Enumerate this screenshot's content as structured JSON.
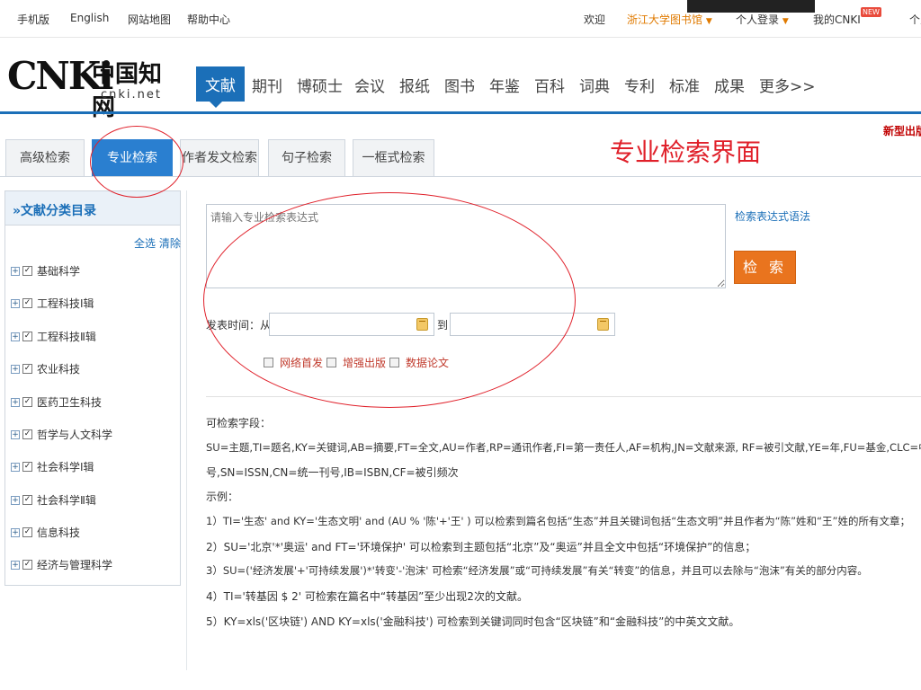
{
  "topbar": {
    "mobile": "手机版",
    "english": "English",
    "sitemap": "网站地图",
    "help": "帮助中心",
    "welcome": "欢迎",
    "library": "浙江大学图书馆",
    "login": "个人登录",
    "my_cnki": "我的CNKI",
    "new_badge": "NEW",
    "personal": "个人"
  },
  "logo": {
    "brand": "CNKi",
    "cn": "中国知网",
    "domain": "cnki.net"
  },
  "nav": {
    "items": [
      "文献",
      "期刊",
      "博硕士",
      "会议",
      "报纸",
      "图书",
      "年鉴",
      "百科",
      "词典",
      "专利",
      "标准",
      "成果",
      "更多>>"
    ],
    "active": "文献"
  },
  "new_edition": "新型出版",
  "tabs": {
    "items": [
      "高级检索",
      "专业检索",
      "作者发文检索",
      "句子检索",
      "一框式检索"
    ],
    "active": "专业检索"
  },
  "annotation": "专业检索界面",
  "sidebar": {
    "title": "»文献分类目录",
    "select_all": "全选",
    "clear": "清除",
    "categories": [
      "基础科学",
      "工程科技Ⅰ辑",
      "工程科技Ⅱ辑",
      "农业科技",
      "医药卫生科技",
      "哲学与人文科学",
      "社会科学Ⅰ辑",
      "社会科学Ⅱ辑",
      "信息科技",
      "经济与管理科学"
    ]
  },
  "form": {
    "expr_placeholder": "请输入专业检索表达式",
    "syntax_link": "检索表达式语法",
    "search_button": "检 索",
    "time_label": "发表时间：从",
    "to_label": "到",
    "options": [
      "网络首发",
      "增强出版",
      "数据论文"
    ]
  },
  "help": {
    "fields_title": "可检索字段：",
    "fields_line1": "SU=主题,TI=题名,KY=关键词,AB=摘要,FT=全文,AU=作者,RP=通讯作者,FI=第一责任人,AF=机构,JN=文献来源, RF=被引文献,YE=年,FU=基金,CLC=中图分类",
    "fields_line2": "号,SN=ISSN,CN=统一刊号,IB=ISBN,CF=被引频次",
    "examples_title": "示例：",
    "examples": [
      "1）TI='生态' and KY='生态文明' and (AU % '陈'+'王' ) 可以检索到篇名包括“生态”并且关键词包括“生态文明”并且作者为“陈”姓和“王”姓的所有文章；",
      "2）SU='北京'*'奥运' and FT='环境保护' 可以检索到主题包括“北京”及“奥运”并且全文中包括“环境保护”的信息；",
      "3）SU=('经济发展'+'可持续发展')*'转变'-'泡沫' 可检索“经济发展”或“可持续发展”有关“转变”的信息，并且可以去除与“泡沫”有关的部分内容。",
      "4）TI='转基因 $ 2' 可检索在篇名中“转基因”至少出现2次的文献。",
      "5）KY=xls('区块链') AND KY=xls('金融科技') 可检索到关键词同时包含“区块链”和“金融科技”的中英文文献。"
    ]
  },
  "colors": {
    "accent": "#1b6fb8",
    "search_button": "#e9741e",
    "annotation_red": "#e0202a"
  }
}
